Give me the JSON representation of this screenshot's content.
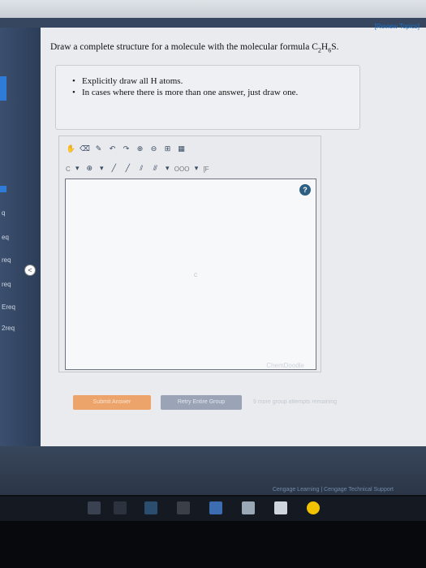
{
  "header": {
    "review_link": "[Review Topics]"
  },
  "question": {
    "text_prefix": "Draw a complete structure for a molecule with the molecular formula C",
    "sub1": "2",
    "mid": "H",
    "sub2": "6",
    "suffix": "S."
  },
  "hints": [
    "Explicitly draw all H atoms.",
    "In cases where there is more than one answer, just draw one."
  ],
  "sidebar": {
    "items": [
      "q",
      "eq",
      "req",
      "req",
      "Ereq",
      "2req"
    ]
  },
  "sketcher": {
    "row2_labels": {
      "carbon": "C",
      "ring_label": "OOO",
      "bracket": "[F"
    },
    "canvas_mark": "C",
    "brand": "ChemDoodle"
  },
  "actions": {
    "submit": "Submit Answer",
    "retry": "Retry Entire Group",
    "attempts": "9 more group attempts remaining"
  },
  "footer": "Cengage Learning | Cengage Technical Support",
  "colors": {
    "sidebar": "#2b3d58",
    "submit": "#eda46a",
    "retry": "#9aa4b6",
    "help": "#2b5f83"
  }
}
